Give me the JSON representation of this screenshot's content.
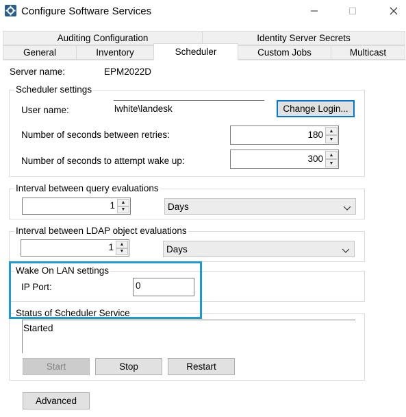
{
  "window": {
    "title": "Configure Software Services"
  },
  "tabs": {
    "row1": [
      {
        "label": "Auditing Configuration"
      },
      {
        "label": "Identity Server Secrets"
      }
    ],
    "row2": [
      {
        "label": "General"
      },
      {
        "label": "Inventory"
      },
      {
        "label": "Scheduler"
      },
      {
        "label": "Custom Jobs"
      },
      {
        "label": "Multicast"
      }
    ],
    "active": "Scheduler"
  },
  "server": {
    "label": "Server name:",
    "value": "EPM2022D"
  },
  "scheduler_settings": {
    "legend": "Scheduler settings",
    "username_label": "User name:",
    "username_value": "lwhite\\landesk",
    "change_login_label": "Change Login...",
    "retries_label": "Number of seconds between retries:",
    "retries_value": "180",
    "wakeup_label": "Number of seconds to attempt wake up:",
    "wakeup_value": "300"
  },
  "query_interval": {
    "legend": "Interval between query evaluations",
    "value": "1",
    "unit": "Days"
  },
  "ldap_interval": {
    "legend": "Interval between LDAP object evaluations",
    "value": "1",
    "unit": "Days"
  },
  "wol": {
    "legend": "Wake On LAN settings",
    "port_label": "IP Port:",
    "port_value": "0"
  },
  "status": {
    "legend": "Status of Scheduler Service",
    "text": "Started",
    "start_label": "Start",
    "stop_label": "Stop",
    "restart_label": "Restart"
  },
  "advanced_label": "Advanced",
  "colors": {
    "highlight": "#1a9ad6",
    "focus": "#0078d7"
  }
}
